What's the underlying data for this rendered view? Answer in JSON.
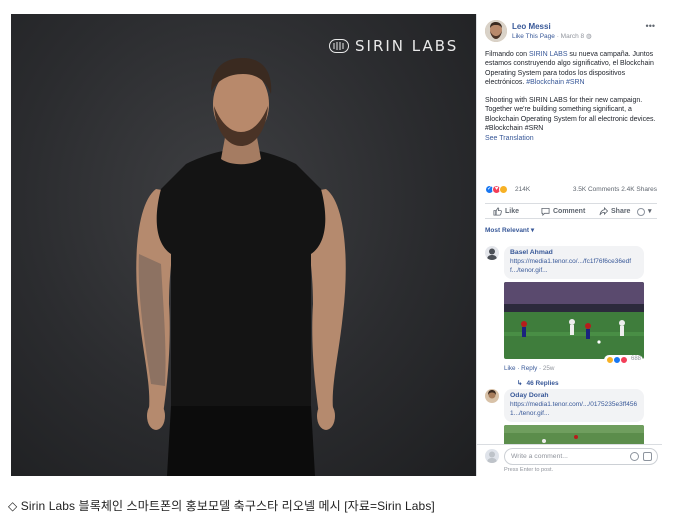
{
  "photo": {
    "brand": "SIRIN LABS"
  },
  "post": {
    "page_name": "Leo Messi",
    "like_page_label": "Like This Page",
    "separator": " · ",
    "date": "March 8",
    "more_icon": "more-dots-icon",
    "spanish_text_lines": [
      "Filmando con ",
      "SIRIN LABS",
      " su nueva campaña. Juntos estamos construyendo algo significativo, el Blockchain Operating System para todos los dispositivos electrónicos. ",
      "#Blockchain #SRN"
    ],
    "english_text": "Shooting with SIRIN LABS for their new campaign. Together we're building something significant, a Blockchain Operating System for all electronic devices. #Blockchain #SRN",
    "see_translation": "See Translation",
    "reaction_count": "214K",
    "comments_shares": "3.5K Comments  2.4K Shares",
    "actions": {
      "like": "Like",
      "comment": "Comment",
      "share": "Share"
    },
    "sort_label": "Most Relevant ▾"
  },
  "comments": [
    {
      "author": "Basel Ahmad",
      "link": "https://media1.tenor.co/.../fc1f76f6ce36edff.../tenor.gif...",
      "like_label": "Like",
      "reply_label": "Reply",
      "timestamp": "25w",
      "reaction_count": "688",
      "replies_label": "46 Replies"
    },
    {
      "author": "Oday Dorah",
      "link": "https://media1.tenor.com/.../0175235e3ff4561.../tenor.gif..."
    }
  ],
  "composer": {
    "placeholder": "Write a comment...",
    "hint": "Press Enter to post."
  },
  "caption": "◇ Sirin Labs 블록체인 스마트폰의 홍보모델 축구스타 리오넬 메시 [자료=Sirin Labs]",
  "colors": {
    "link_blue": "#385898",
    "photo_bg": "#2b2c2f",
    "like_blue": "#1877f2",
    "love_red": "#f33e58",
    "wow_yellow": "#f7b125"
  }
}
